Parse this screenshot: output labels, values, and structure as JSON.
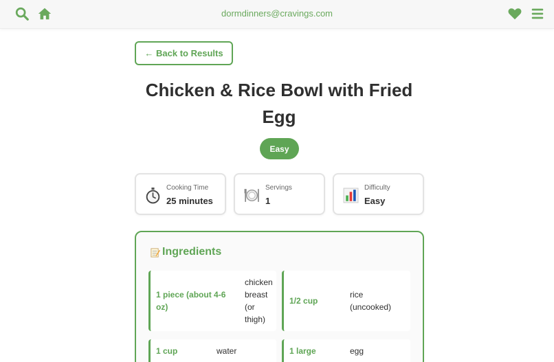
{
  "header": {
    "email": "dormdinners@cravings.com",
    "icons": [
      "search-icon",
      "home-icon",
      "heart-icon",
      "menu-icon"
    ],
    "accent_color": "#5fa555"
  },
  "back_button": {
    "label": "← Back to Results"
  },
  "recipe": {
    "title": "Chicken & Rice Bowl with Fried Egg",
    "difficulty_badge": "Easy"
  },
  "stats": [
    {
      "icon": "stopwatch-icon",
      "label": "Cooking Time",
      "value": "25 minutes"
    },
    {
      "icon": "plate-icon",
      "label": "Servings",
      "value": "1"
    },
    {
      "icon": "bar-chart-icon",
      "label": "Difficulty",
      "value": "Easy"
    }
  ],
  "ingredients": {
    "heading": "Ingredients",
    "heading_icon": "memo-icon",
    "items": [
      {
        "qty": "1 piece (about 4-6 oz)",
        "name": "chicken breast (or thigh)"
      },
      {
        "qty": "1/2 cup",
        "name": "rice (uncooked)"
      },
      {
        "qty": "1 cup",
        "name": "water"
      },
      {
        "qty": "1 large",
        "name": "egg"
      }
    ]
  }
}
